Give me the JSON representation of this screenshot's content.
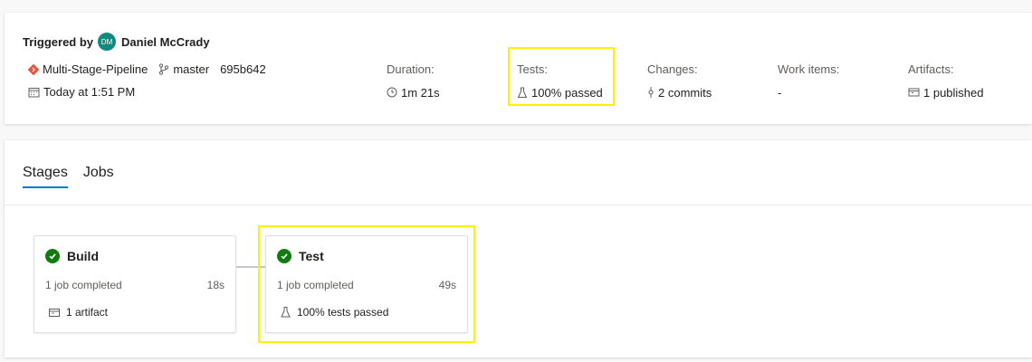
{
  "summary": {
    "triggered_label": "Triggered by",
    "user_initials": "DM",
    "user_name": "Daniel McCrady",
    "pipeline_name": "Multi-Stage-Pipeline",
    "branch": "master",
    "commit": "695b642",
    "date": "Today at 1:51 PM",
    "duration": {
      "label": "Duration:",
      "value": "1m 21s"
    },
    "tests": {
      "label": "Tests:",
      "value": "100% passed"
    },
    "changes": {
      "label": "Changes:",
      "value": "2 commits"
    },
    "work_items": {
      "label": "Work items:",
      "value": "-"
    },
    "artifacts": {
      "label": "Artifacts:",
      "value": "1 published"
    }
  },
  "tabs": [
    {
      "label": "Stages",
      "active": true
    },
    {
      "label": "Jobs",
      "active": false
    }
  ],
  "stages": [
    {
      "name": "Build",
      "jobs": "1 job completed",
      "time": "18s",
      "extra": "1 artifact"
    },
    {
      "name": "Test",
      "jobs": "1 job completed",
      "time": "49s",
      "extra": "100% tests passed"
    }
  ],
  "colors": {
    "accent": "#0078d4",
    "success": "#107c10",
    "highlight": "#fff200",
    "pipeline_icon": "#e8553e",
    "avatar": "#0f8a7e"
  }
}
